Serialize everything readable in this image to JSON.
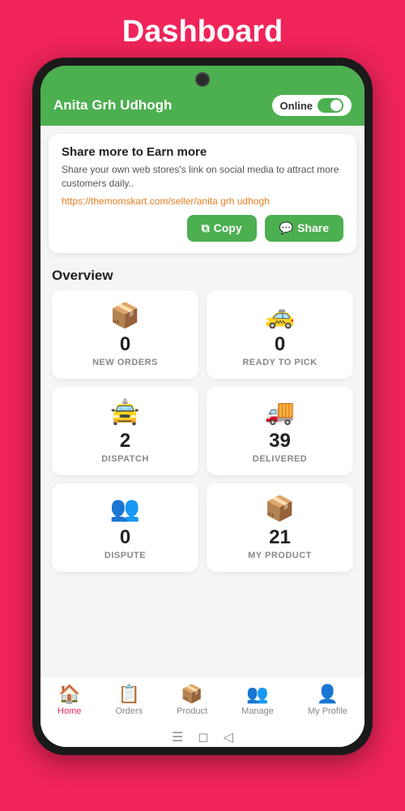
{
  "page": {
    "title": "Dashboard",
    "background_color": "#f0245a"
  },
  "appbar": {
    "user_name": "Anita Grh Udhogh",
    "online_label": "Online"
  },
  "share_card": {
    "title": "Share more to Earn more",
    "description": "Share your own web stores's link on social media to attract more customers daily..",
    "link": "https://themomskart.com/seller/anita grh udhogh",
    "copy_label": "Copy",
    "share_label": "Share"
  },
  "overview": {
    "title": "Overview",
    "stats": [
      {
        "icon": "📦",
        "value": "0",
        "label": "NEW ORDERS"
      },
      {
        "icon": "🚕",
        "value": "0",
        "label": "READY TO PICK"
      },
      {
        "icon": "🚖",
        "value": "2",
        "label": "DISPATCH"
      },
      {
        "icon": "🚚",
        "value": "39",
        "label": "DELIVERED"
      },
      {
        "icon": "👥",
        "value": "0",
        "label": "DISPUTE"
      },
      {
        "icon": "📦",
        "value": "21",
        "label": "MY PRODUCT"
      }
    ]
  },
  "bottom_nav": {
    "items": [
      {
        "icon": "🏠",
        "label": "Home",
        "active": true
      },
      {
        "icon": "📋",
        "label": "Orders",
        "active": false
      },
      {
        "icon": "📦",
        "label": "Product",
        "active": false
      },
      {
        "icon": "👥",
        "label": "Manage",
        "active": false
      },
      {
        "icon": "👤",
        "label": "My Profile",
        "active": false
      }
    ]
  }
}
